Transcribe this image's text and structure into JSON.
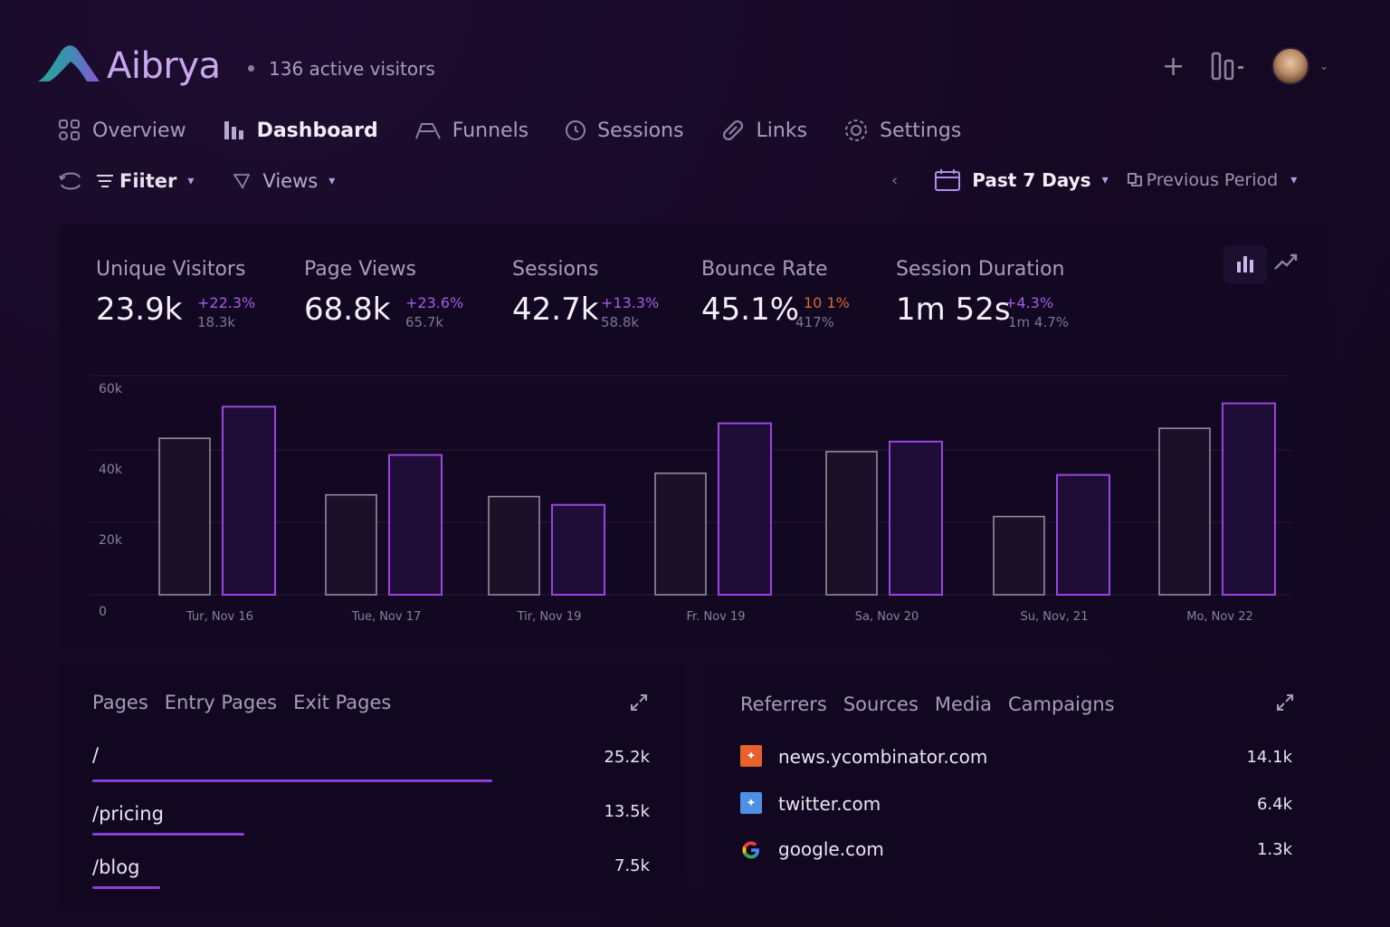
{
  "app": {
    "name": "Aibrya",
    "active_visitors": "136 active visitors"
  },
  "nav": [
    {
      "label": "Overview",
      "icon": "grid-icon"
    },
    {
      "label": "Dashboard",
      "icon": "bar-chart-icon",
      "active": true
    },
    {
      "label": "Funnels",
      "icon": "funnel-icon"
    },
    {
      "label": "Sessions",
      "icon": "clock-icon"
    },
    {
      "label": "Links",
      "icon": "link-icon"
    },
    {
      "label": "Settings",
      "icon": "gear-icon"
    }
  ],
  "filters": {
    "filter_label": "Fiiter",
    "views_label": "Views",
    "period_label": "Past 7 Days",
    "compare_label": "Previous Period"
  },
  "metrics": [
    {
      "label": "Unique Visitors",
      "value": "23.9k",
      "delta": "+22.3%",
      "previous": "18.3k"
    },
    {
      "label": "Page Views",
      "value": "68.8k",
      "delta": "+23.6%",
      "previous": "65.7k"
    },
    {
      "label": "Sessions",
      "value": "42.7k",
      "delta": "+13.3%",
      "previous": "58.8k"
    },
    {
      "label": "Bounce Rate",
      "value": "45.1%",
      "delta": "10 1%",
      "previous": "417%"
    },
    {
      "label": "Session Duration",
      "value": "1m 52s",
      "delta": "+4.3%",
      "previous": "1m 4.7%"
    }
  ],
  "chart_data": {
    "type": "bar",
    "categories": [
      "Tur, Nov 16",
      "Tue, Nov 17",
      "Tir, Nov 19",
      "Fr. Nov 19",
      "Sa, Nov 20",
      "Su, Nov, 21",
      "Mo, Nov 22"
    ],
    "series": [
      {
        "values": [
          47000,
          30000,
          29500,
          36500,
          43000,
          23500,
          50000
        ]
      },
      {
        "values": [
          56500,
          42000,
          27000,
          51500,
          46000,
          36000,
          57500
        ]
      }
    ],
    "yticks": [
      "60k",
      "40k",
      "20k",
      "0"
    ],
    "ylim": [
      0,
      62000
    ],
    "colors": {
      "previous": "#9a92a8",
      "current": "#9b45e0"
    }
  },
  "pages_card": {
    "tabs": [
      "Pages",
      "Entry Pages",
      "Exit Pages"
    ],
    "rows": [
      {
        "label": "/",
        "value": "25.2k",
        "share": 1.0
      },
      {
        "label": "/pricing",
        "value": "13.5k",
        "share": 0.38
      },
      {
        "label": "/blog",
        "value": "7.5k",
        "share": 0.17
      }
    ]
  },
  "ref_card": {
    "tabs": [
      "Referrers",
      "Sources",
      "Media",
      "Campaigns"
    ],
    "rows": [
      {
        "label": "news.ycombinator.com",
        "value": "14.1k",
        "icon": "hackernews-icon",
        "color": "#e8612c"
      },
      {
        "label": "twitter.com",
        "value": "6.4k",
        "icon": "twitter-icon",
        "color": "#4f8fe6"
      },
      {
        "label": "google.com",
        "value": "1.3k",
        "icon": "google-icon",
        "color": "#ffffff"
      }
    ]
  }
}
